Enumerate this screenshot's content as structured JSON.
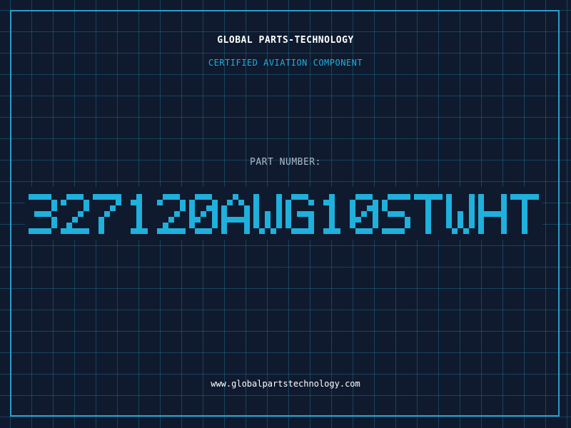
{
  "header": {
    "company": "GLOBAL PARTS-TECHNOLOGY",
    "tagline": "CERTIFIED AVIATION COMPONENT"
  },
  "part": {
    "label": "PART NUMBER:",
    "number": "327120AWG10STWHT"
  },
  "footer": {
    "url": "www.globalpartstechnology.com"
  },
  "colors": {
    "background": "#0f1a2e",
    "grid": "#1e7896",
    "frame": "#2a9ec9",
    "accent": "#1fb0dc",
    "text": "#ffffff",
    "muted": "#aeb9c9"
  }
}
